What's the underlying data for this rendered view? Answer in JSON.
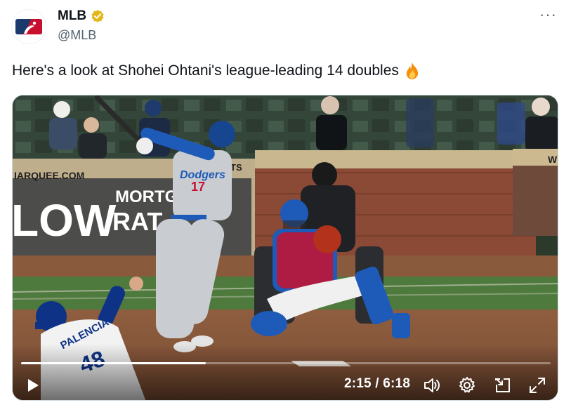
{
  "author": {
    "display_name": "MLB",
    "handle": "@MLB",
    "verified": true,
    "avatar_icon": "mlb-logo-icon",
    "verified_icon": "verified-badge-icon",
    "verified_color": "#e2b719"
  },
  "more_menu": {
    "icon": "more-options-icon",
    "label": "···"
  },
  "tweet": {
    "text": "Here's a look at Shohei Ohtani's league-leading 14 doubles",
    "emoji": "fire-emoji-icon"
  },
  "video": {
    "scene_text": {
      "banner_left": "IARQUEE.COM",
      "banner_ts": "TS",
      "banner_right": "W",
      "ad_big": "LOW",
      "ad_top": "MORTG",
      "ad_bottom": "RAT",
      "batter_jersey_front": "17",
      "batter_team": "Dodgers",
      "pitcher_name": "PALENCIA",
      "pitcher_number": "48"
    },
    "progress": 0.349,
    "time_display": "2:15 / 6:18",
    "controls": {
      "play_icon": "play-icon",
      "volume_icon": "volume-icon",
      "settings_icon": "settings-gear-icon",
      "pip_icon": "picture-in-picture-icon",
      "fullscreen_icon": "fullscreen-icon"
    }
  },
  "colors": {
    "text_primary": "#0f1419",
    "text_secondary": "#536471",
    "mlb_blue": "#1a3a6e",
    "mlb_red": "#c8102e",
    "dodger_blue": "#1e5bb8",
    "cubs_blue": "#0e3386",
    "field_grass": "#4e7a3e",
    "dirt": "#8a5a3c"
  }
}
